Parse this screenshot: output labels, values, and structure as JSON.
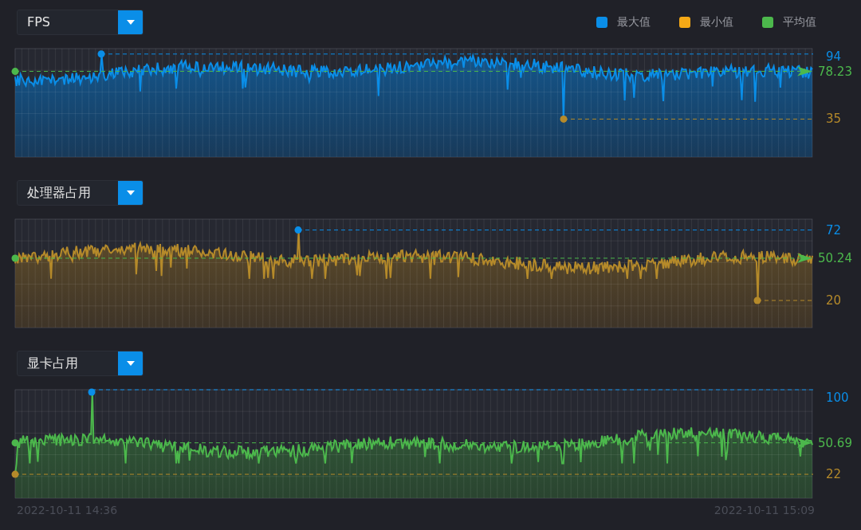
{
  "legend": [
    {
      "label": "最大值",
      "color": "#0a8ee8"
    },
    {
      "label": "最小值",
      "color": "#f5a916"
    },
    {
      "label": "平均值",
      "color": "#4cb84c"
    }
  ],
  "panels": [
    {
      "kind": "fps",
      "select": {
        "value": "FPS"
      },
      "max_label": "94",
      "avg_label": "78.23",
      "min_label": "35"
    },
    {
      "kind": "cpu",
      "select": {
        "value": "处理器占用"
      },
      "max_label": "72",
      "avg_label": "50.24",
      "min_label": "20"
    },
    {
      "kind": "gpu",
      "select": {
        "value": "显卡占用"
      },
      "max_label": "100",
      "avg_label": "50.69",
      "min_label": "22"
    }
  ],
  "time_axis": {
    "start": "2022-10-11 14:36",
    "end": "2022-10-11 15:09"
  }
}
